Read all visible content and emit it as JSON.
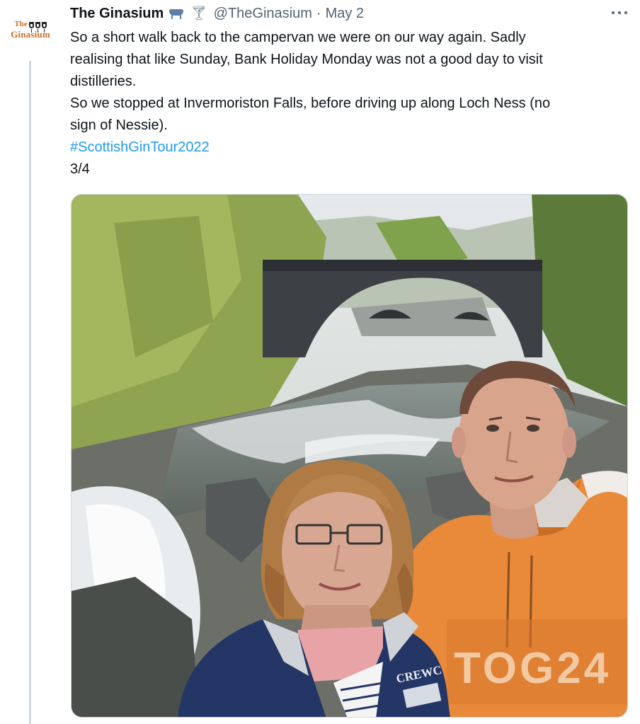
{
  "account": {
    "display_name": "The Ginasium",
    "handle": "@TheGinasium",
    "separator": "·",
    "date": "May 2",
    "avatar_text_top": "The",
    "avatar_text_bottom": "Ginasium",
    "name_emojis": [
      "vat-icon",
      "martini-icon"
    ]
  },
  "tweet": {
    "lines": [
      "So a short walk back to the campervan we were on our way again. Sadly",
      "realising that like Sunday, Bank Holiday Monday was not a good day to visit",
      "distilleries.",
      "So we stopped at Invermoriston Falls, before driving up along Loch Ness (no",
      "sign of Nessie)."
    ],
    "hashtag": "#ScottishGinTour2022",
    "counter": "3/4"
  },
  "photo": {
    "hoodie_text": "TOG24",
    "jacket_text": "CREWC"
  },
  "colors": {
    "link": "#1d9bf0",
    "secondary_text": "#536471",
    "thread_line": "#cfd9de",
    "brand_orange": "#d2691e"
  }
}
